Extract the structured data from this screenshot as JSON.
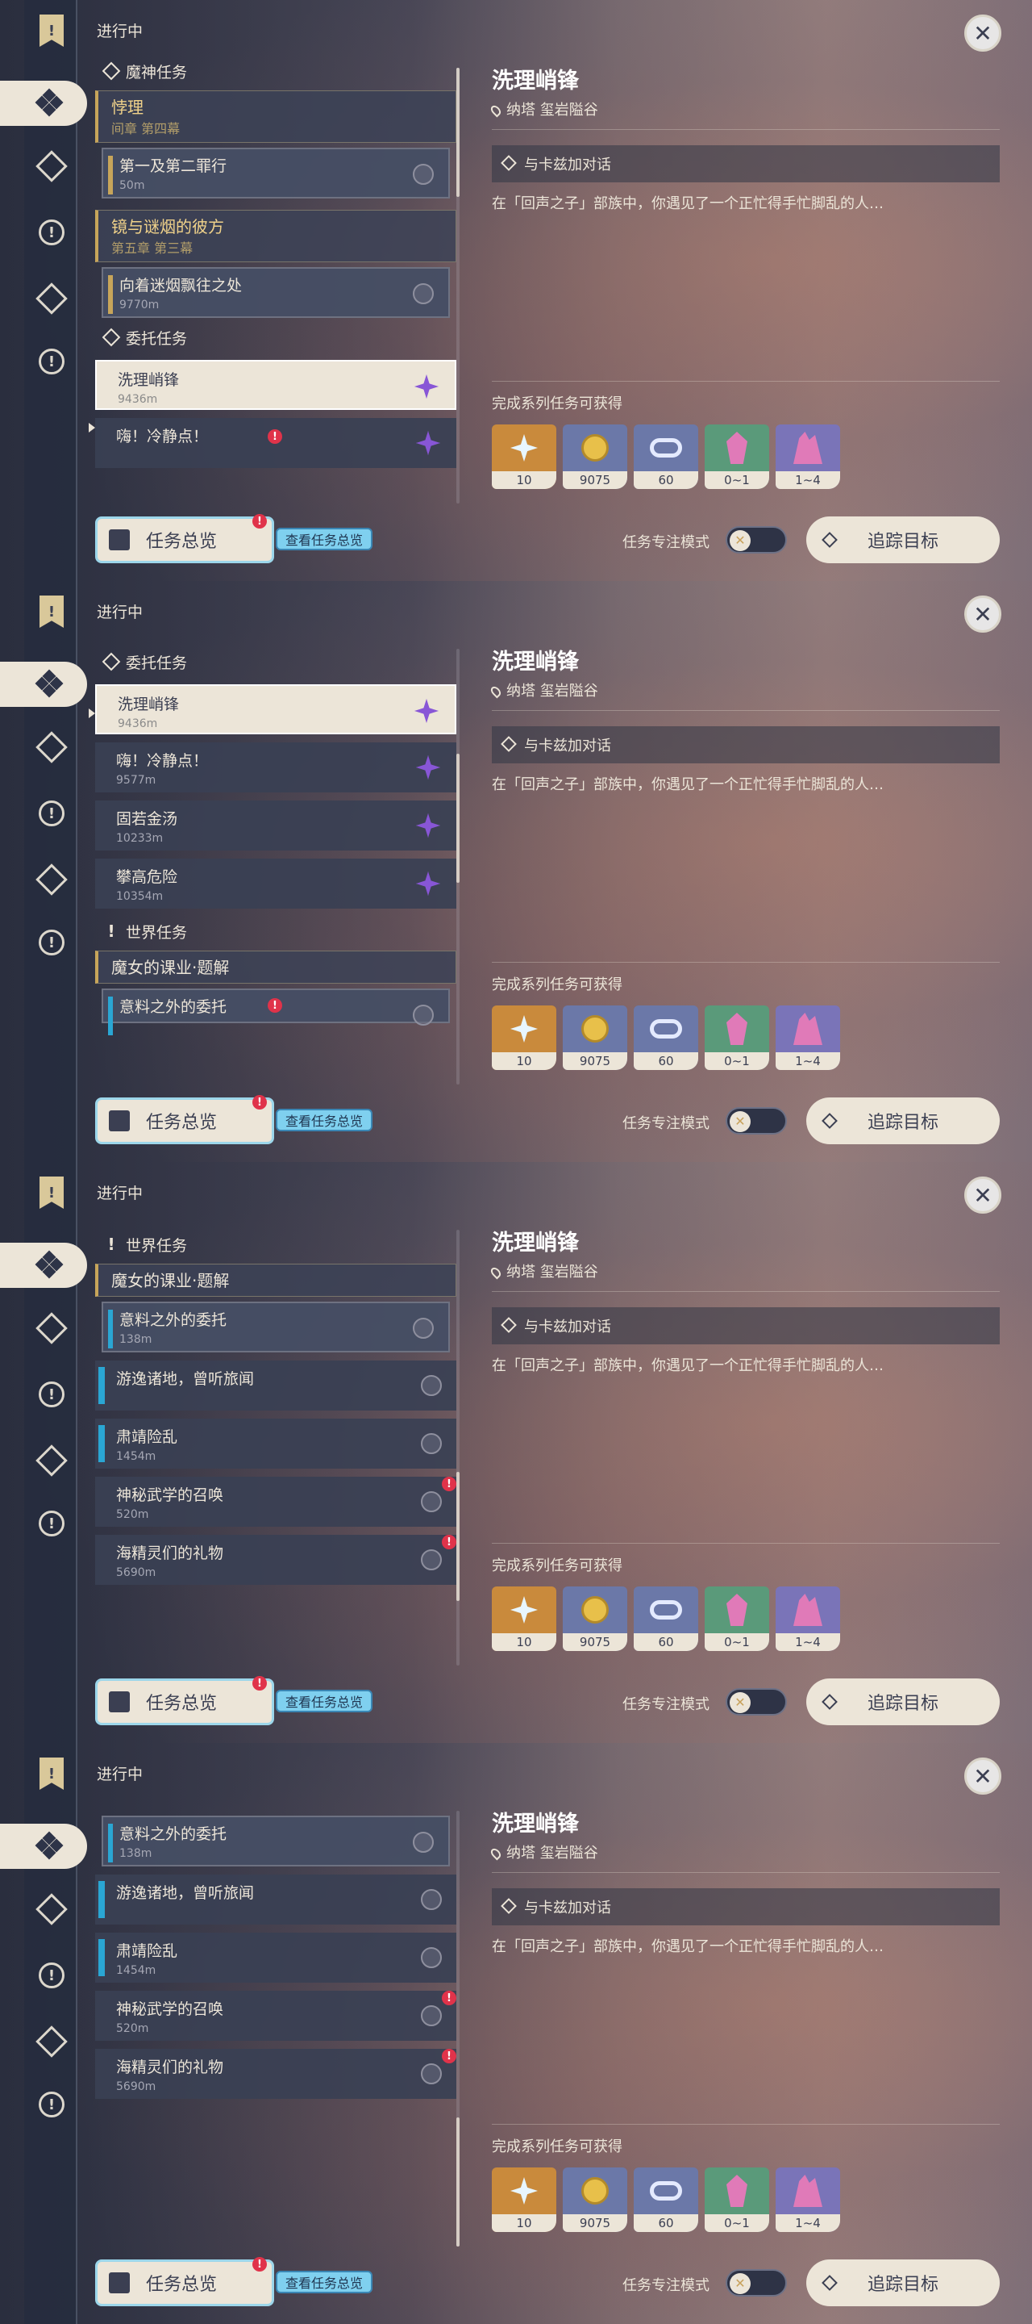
{
  "status_title": "进行中",
  "rail": [
    {
      "icon": "bookmark-icon"
    },
    {
      "icon": "archon-quest-icon"
    },
    {
      "icon": "story-quest-icon"
    },
    {
      "icon": "world-quest-icon"
    },
    {
      "icon": "commission-quest-icon"
    },
    {
      "icon": "event-quest-icon"
    }
  ],
  "sections": {
    "archon": "魔神任务",
    "commission": "委托任务",
    "world": "世界任务"
  },
  "archon_groups": [
    {
      "title": "悖理",
      "subtitle": "间章 第四幕",
      "sub_title": "第一及第二罪行",
      "sub_distance": "50m"
    },
    {
      "title": "镜与谜烟的彼方",
      "subtitle": "第五章 第三幕",
      "sub_title": "向着迷烟飘往之处",
      "sub_distance": "9770m"
    }
  ],
  "commissions": [
    {
      "title": "洗理峭锋",
      "distance": "9436m"
    },
    {
      "title": "嗨！冷静点！",
      "distance": "9577m"
    },
    {
      "title": "固若金汤",
      "distance": "10233m"
    },
    {
      "title": "攀高危险",
      "distance": "10354m"
    }
  ],
  "world_group": {
    "title": "魔女的课业·题解",
    "sub_title": "意料之外的委托",
    "sub_distance": "138m"
  },
  "world_quests": [
    {
      "title": "游逸诸地，曾听旅闻",
      "distance": ""
    },
    {
      "title": "肃靖险乱",
      "distance": "1454m"
    },
    {
      "title": "神秘武学的召唤",
      "distance": "520m"
    },
    {
      "title": "海精灵们的礼物",
      "distance": "5690m"
    }
  ],
  "overview_label": "任务总览",
  "overview_tip": "查看任务总览",
  "close_icon": "close-icon",
  "detail": {
    "title": "洗理峭锋",
    "location": "纳塔 玺岩隘谷",
    "objective": "与卡兹加对话",
    "description": "在「回声之子」部族中，你遇见了一个正忙得手忙脚乱的人…",
    "rewards_title": "完成系列任务可获得",
    "rewards": [
      {
        "icon": "primogem-icon",
        "count": "10",
        "color": "#c98a3c"
      },
      {
        "icon": "mora-icon",
        "count": "9075",
        "color": "#6b78a8"
      },
      {
        "icon": "adventure-exp-icon",
        "count": "60",
        "color": "#6b78a8"
      },
      {
        "icon": "crystal-ore-icon",
        "count": "0~1",
        "color": "#5a9a7a"
      },
      {
        "icon": "crystal-cluster-icon",
        "count": "1~4",
        "color": "#7a74b8"
      }
    ]
  },
  "focus_mode_label": "任务专注模式",
  "track_label": "追踪目标"
}
